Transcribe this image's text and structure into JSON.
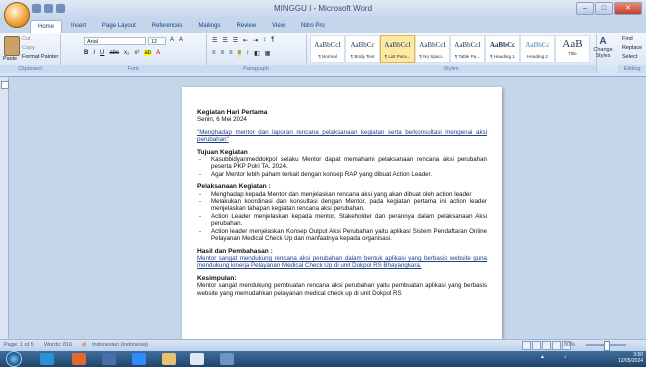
{
  "window": {
    "title": "MINGGU I - Microsoft Word"
  },
  "ribbon": {
    "tabs": [
      "Home",
      "Insert",
      "Page Layout",
      "References",
      "Mailings",
      "Review",
      "View",
      "Nitro Pro"
    ],
    "clipboard": {
      "label": "Clipboard",
      "paste": "Paste",
      "cut": "Cut",
      "copy": "Copy",
      "format_painter": "Format Painter"
    },
    "font": {
      "label": "Font",
      "name": "Arial",
      "size": "12"
    },
    "paragraph": {
      "label": "Paragraph"
    },
    "styles": {
      "label": "Styles",
      "items": [
        {
          "sample": "AaBbCcI",
          "name": "¶ Normal"
        },
        {
          "sample": "AaBbCc",
          "name": "¶ Body Text"
        },
        {
          "sample": "AaBbCcI",
          "name": "¶ List Para..."
        },
        {
          "sample": "AaBbCcI",
          "name": "¶ No Spaci..."
        },
        {
          "sample": "AaBbCcI",
          "name": "¶ Table Pa..."
        },
        {
          "sample": "AaBbCc",
          "name": "¶ Heading 1"
        },
        {
          "sample": "AaBbCc",
          "name": "Heading 2"
        },
        {
          "sample": "AaB",
          "name": "Title"
        }
      ],
      "change_styles": "Change Styles"
    },
    "editing": {
      "label": "Editing",
      "find": "Find",
      "replace": "Replace",
      "select": "Select"
    }
  },
  "document": {
    "title": "Kegiatan Hari Pertama",
    "date": "Senin, 6 Mei 2024",
    "quote": "\"Menghadap mentor dan laporan rencana pelaksanaan kegiatan serta berkonsultasi mengenai aksi perubahan\"",
    "tujuan_heading": "Tujuan Kegiatan",
    "tujuan_items": [
      "Kasubbidyanmeddokpol selaku Mentor dapat memahami pelaksanaan rencana aksi perubahan peserta PKP Polri TA. 2024.",
      "Agar Mentor lebih paham terkait dengan konsep RAP yang dibuat Action Leader."
    ],
    "pelaksanaan_heading": "Pelaksanaan Kegiatan :",
    "pelaksanaan_items": [
      "Menghadap kepada Mentor dan menjelaskan rencana aksi yang akan dibuat oleh action leader",
      "Melakukan koordinasi dan konsultasi dengan Mentor, pada kegiatan pertama ini action leader menjelaskan tahapan kegiatan rencana aksi perubahan.",
      "Action Leader menjelaskan kepada mentor, Stakeholder dan perannya dalam pelaksanaan Aksi perubahan.",
      "Action leader menjelaskan Konsep Output Aksi Perubahan yaitu aplikasi Sistem Pendaftaran Online Pelayanan Medical Check Up dan manfaatnya kepada organisasi."
    ],
    "hasil_heading": "Hasil dan Pembahasan :",
    "hasil_text": "Mentor sangat mendukung rencana aksi perubahan dalam bentuk aplikasi yang berbasis website guna mendukung kinerja Pelayanan Medical Check Up di unit Dokpol RS Bhayangkara.",
    "kesimpulan_heading": "Kesimpulan:",
    "kesimpulan_text": "Mentor sangat mendukung pembuatan rencana aksi perubahan yaitu pembuatan aplikasi yang berbasis website yang memudahkan pelayanan medical check up di unit Dokpol RS"
  },
  "statusbar": {
    "page": "Page: 1 of 5",
    "words": "Words: 816",
    "language": "Indonesian (Indonesia)",
    "zoom": "80%"
  },
  "taskbar": {
    "time": "3:50",
    "date": "12/05/2024"
  },
  "colors": {
    "accent": "#15428b",
    "selected_style": "#fde9a2"
  }
}
